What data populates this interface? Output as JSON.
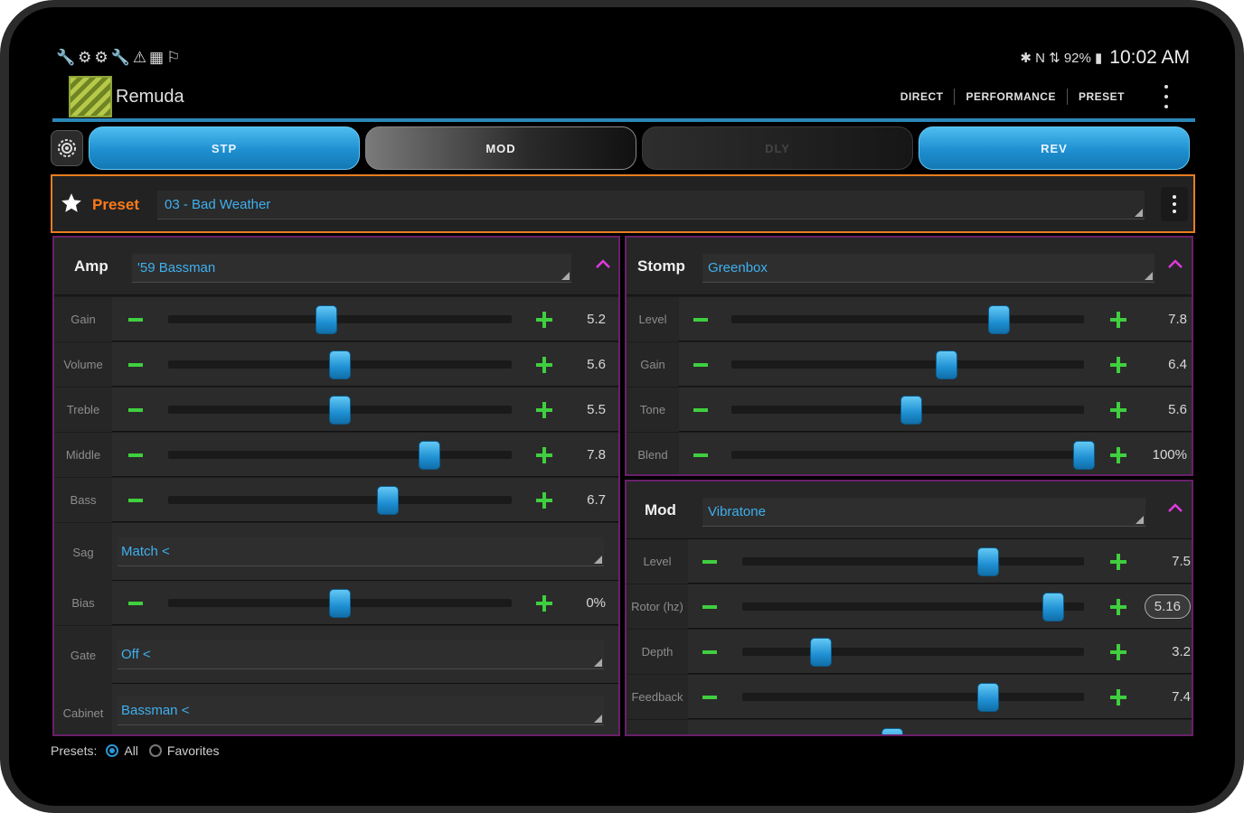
{
  "status": {
    "left_icons": "🔧⚙⚙🔧⚠▦⚐",
    "right_icons": "✱ N ⇅ 92% ▮",
    "time": "10:02 AM"
  },
  "app": {
    "title": "Remuda",
    "menu": [
      "DIRECT",
      "PERFORMANCE",
      "PRESET"
    ]
  },
  "fx_tabs": [
    {
      "label": "STP",
      "state": "on"
    },
    {
      "label": "MOD",
      "state": "mid"
    },
    {
      "label": "DLY",
      "state": "off"
    },
    {
      "label": "REV",
      "state": "on"
    }
  ],
  "preset": {
    "label": "Preset",
    "value": "03 - Bad Weather"
  },
  "amp": {
    "name": "Amp",
    "model": "'59 Bassman",
    "params": [
      {
        "label": "Gain",
        "value": "5.2",
        "level": 0.46
      },
      {
        "label": "Volume",
        "value": "5.6",
        "level": 0.5
      },
      {
        "label": "Treble",
        "value": "5.5",
        "level": 0.5
      },
      {
        "label": "Middle",
        "value": "7.8",
        "level": 0.76
      },
      {
        "label": "Bass",
        "value": "6.7",
        "level": 0.64
      }
    ],
    "sag": {
      "label": "Sag",
      "value": "Match <"
    },
    "bias": {
      "label": "Bias",
      "value": "0%",
      "level": 0.5
    },
    "gate": {
      "label": "Gate",
      "value": "Off <"
    },
    "cabinet": {
      "label": "Cabinet",
      "value": "Bassman <"
    }
  },
  "stomp": {
    "name": "Stomp",
    "model": "Greenbox",
    "params": [
      {
        "label": "Level",
        "value": "7.8",
        "level": 0.76
      },
      {
        "label": "Gain",
        "value": "6.4",
        "level": 0.61
      },
      {
        "label": "Tone",
        "value": "5.6",
        "level": 0.51
      },
      {
        "label": "Blend",
        "value": "100%",
        "level": 1.0
      }
    ]
  },
  "mod": {
    "name": "Mod",
    "model": "Vibratone",
    "params": [
      {
        "label": "Level",
        "value": "7.5",
        "level": 0.72
      },
      {
        "label": "Rotor (hz)",
        "value": "5.16",
        "level": 0.91
      },
      {
        "label": "Depth",
        "value": "3.2",
        "level": 0.23
      },
      {
        "label": "Feedback",
        "value": "7.4",
        "level": 0.72
      },
      {
        "label": "",
        "value": "",
        "level": 0.44
      }
    ]
  },
  "footer": {
    "label": "Presets:",
    "options": [
      "All",
      "Favorites"
    ],
    "selected": "All"
  },
  "colors": {
    "accent_blue": "#2b96d6",
    "preset_orange": "#e87d1f",
    "panel_border": "#6a1f6a",
    "plus_minus_green": "#3fcf3f",
    "caret_magenta": "#e03ae0"
  }
}
